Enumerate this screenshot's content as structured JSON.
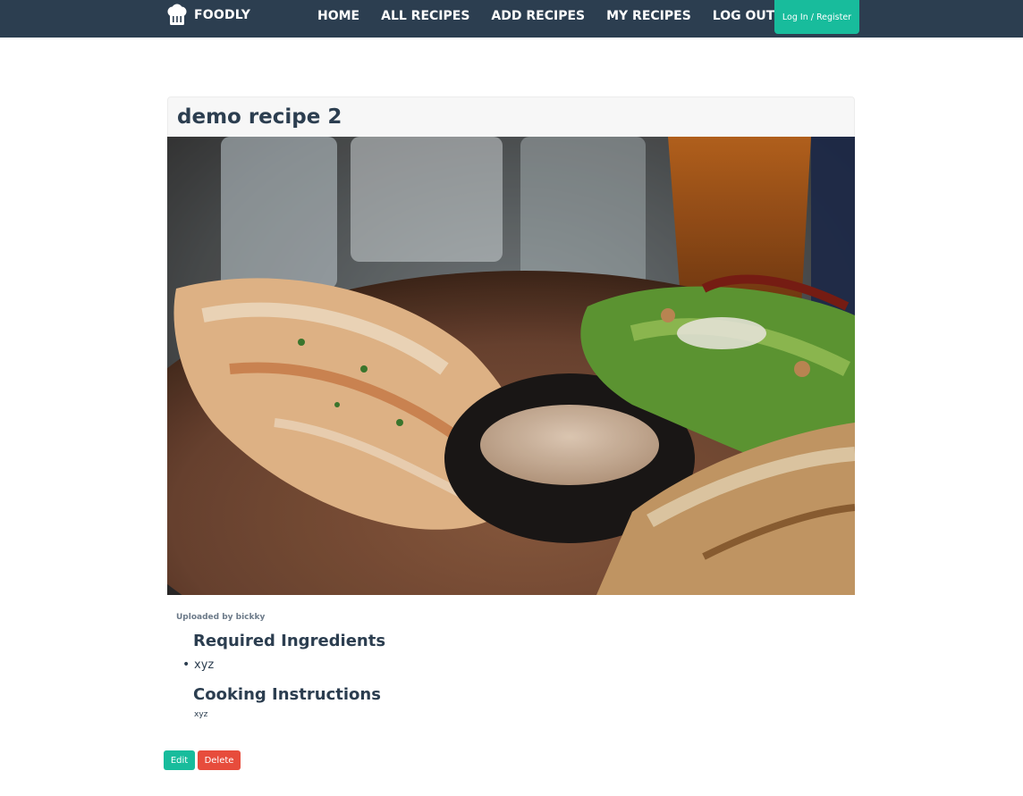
{
  "brand": {
    "name": "FOODLY",
    "icon": "chef-hat-icon"
  },
  "nav": {
    "links": [
      {
        "label": "HOME"
      },
      {
        "label": "ALL RECIPES"
      },
      {
        "label": "ADD RECIPES"
      },
      {
        "label": "MY RECIPES"
      },
      {
        "label": "LOG OUT"
      }
    ],
    "login_label": "Log In / Register"
  },
  "recipe": {
    "title": "demo recipe 2",
    "uploaded_by": "Uploaded by bickky",
    "ingredients_heading": "Required Ingredients",
    "ingredients": [
      "xyz"
    ],
    "instructions_heading": "Cooking Instructions",
    "instructions": "xyz"
  },
  "actions": {
    "edit_label": "Edit",
    "delete_label": "Delete"
  },
  "colors": {
    "navbar": "#2c3e50",
    "accent": "#18bc9c",
    "danger": "#e74c3c",
    "text": "#2c3e50"
  }
}
